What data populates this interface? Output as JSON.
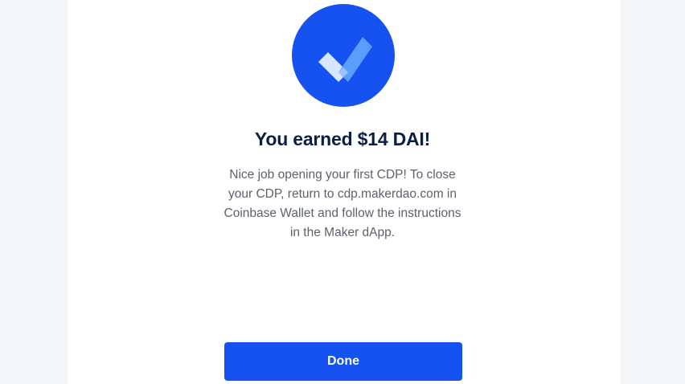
{
  "colors": {
    "brand_blue": "#1652f0",
    "title_text": "#0a1f44",
    "body_text": "#5b616e",
    "check_light": "#d6e6ff",
    "check_mid": "#5b9cff"
  },
  "icon": "checkmark-icon",
  "modal": {
    "title": "You earned $14 DAI!",
    "message": "Nice job opening your first CDP! To close your CDP, return to cdp.makerdao.com in Coinbase Wallet and follow the instructions in the Maker dApp.",
    "done_label": "Done"
  }
}
